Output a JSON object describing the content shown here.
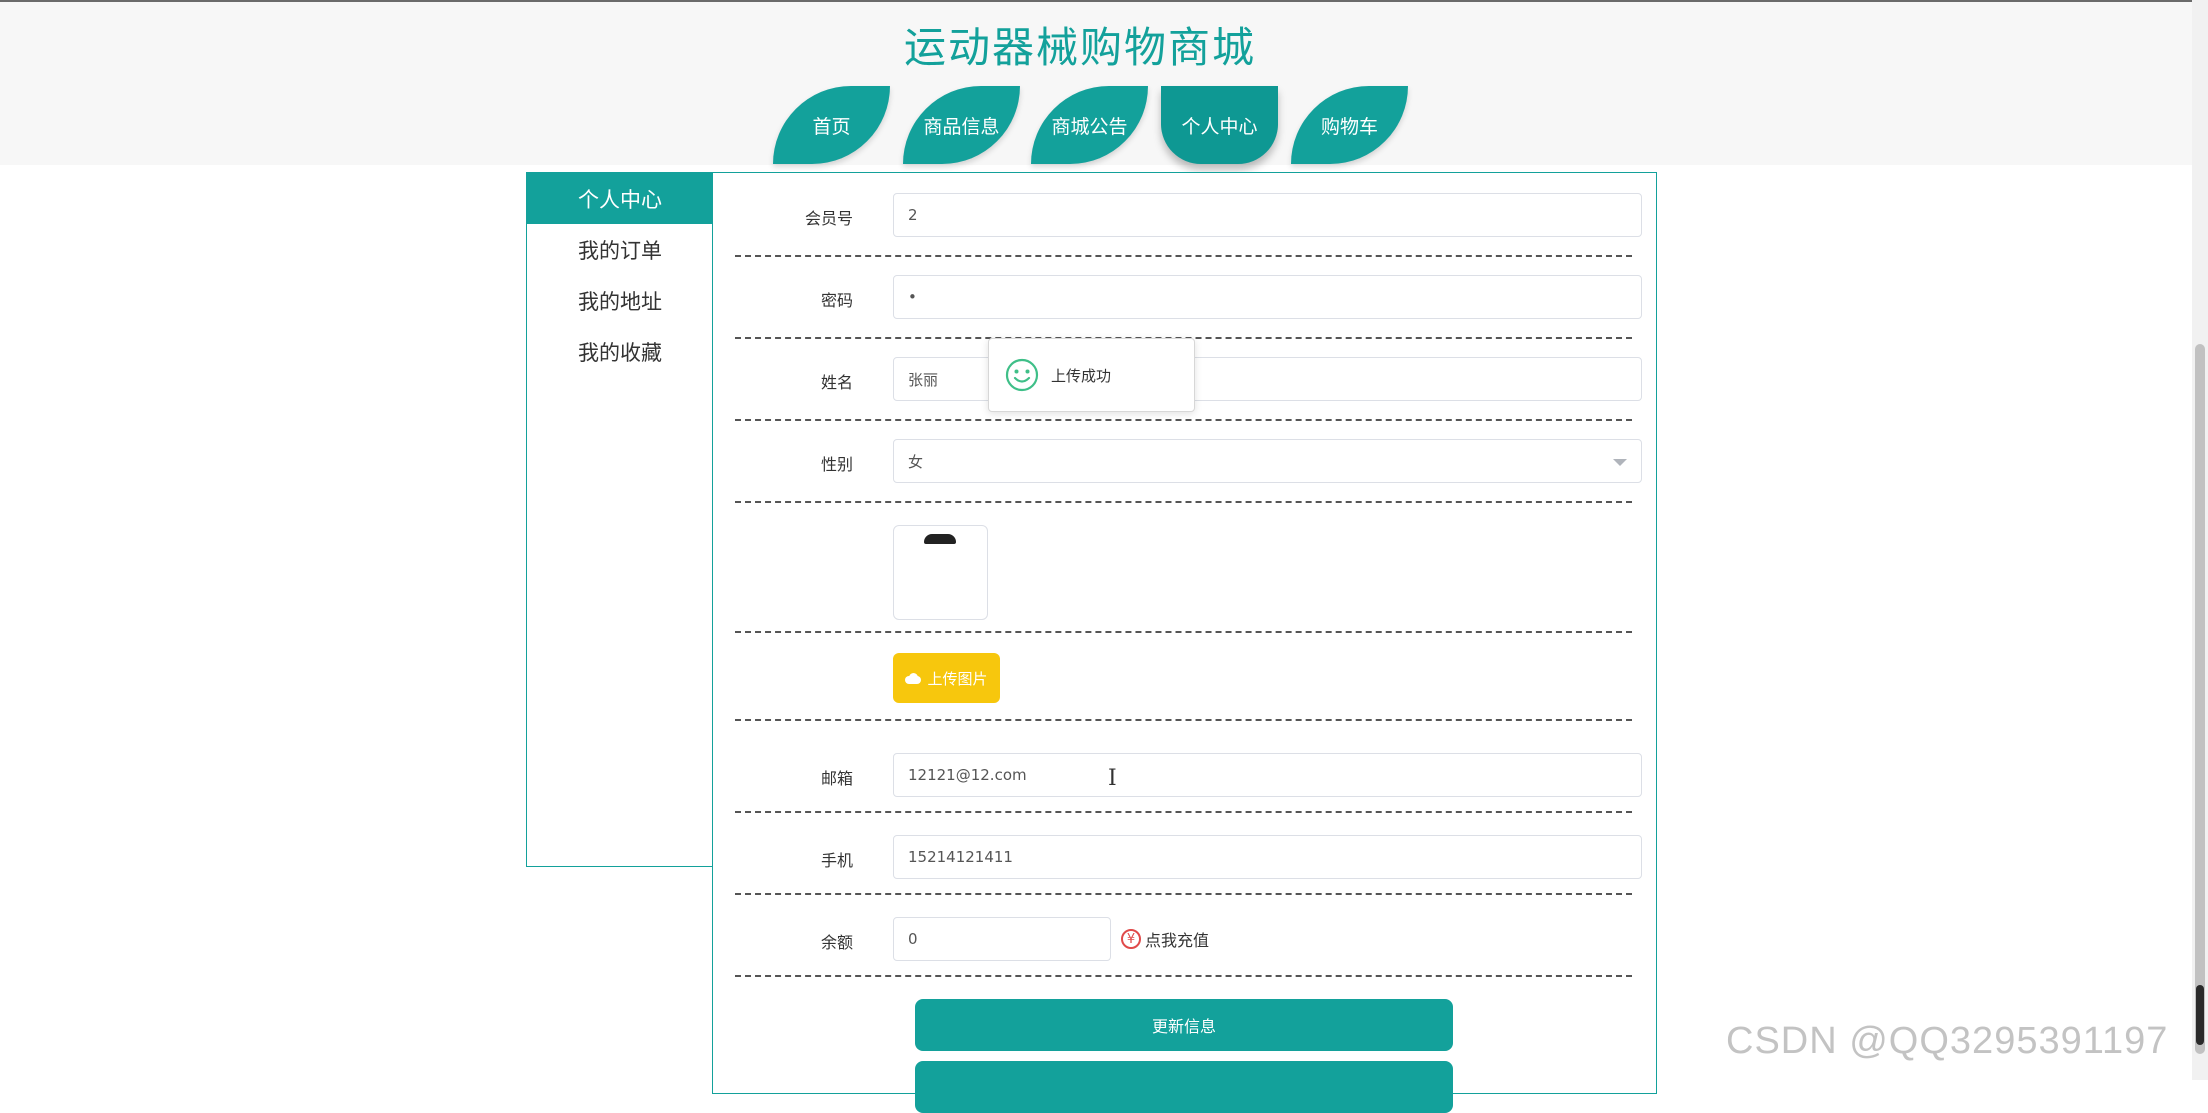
{
  "site": {
    "title": "运动器械购物商城"
  },
  "nav": {
    "items": [
      {
        "label": "首页"
      },
      {
        "label": "商品信息"
      },
      {
        "label": "商城公告"
      },
      {
        "label": "个人中心"
      },
      {
        "label": "购物车"
      }
    ],
    "active": "个人中心"
  },
  "sidebar": {
    "items": [
      {
        "label": "个人中心"
      },
      {
        "label": "我的订单"
      },
      {
        "label": "我的地址"
      },
      {
        "label": "我的收藏"
      }
    ],
    "active": "个人中心"
  },
  "form": {
    "member_no": {
      "label": "会员号",
      "value": "2"
    },
    "password": {
      "label": "密码",
      "value": "•"
    },
    "name": {
      "label": "姓名",
      "value": "张丽"
    },
    "gender": {
      "label": "性别",
      "value": "女"
    },
    "upload_button": "上传图片",
    "email": {
      "label": "邮箱",
      "value": "12121@12.com"
    },
    "phone": {
      "label": "手机",
      "value": "15214121411"
    },
    "balance": {
      "label": "余额",
      "value": "0",
      "recharge_label": "点我充值"
    },
    "update_button": "更新信息"
  },
  "toast": {
    "message": "上传成功"
  },
  "watermark": "CSDN @QQ3295391197",
  "colors": {
    "accent": "#13a19b",
    "upload": "#f7c70d",
    "recharge_icon": "#e04a4a"
  }
}
